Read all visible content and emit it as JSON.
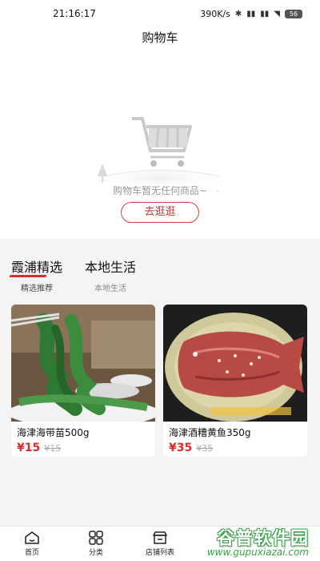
{
  "status_bar": {
    "time": "21:16:17",
    "speed": "390K/s",
    "battery": "56"
  },
  "header": {
    "title": "购物车"
  },
  "empty_state": {
    "message": "购物车暂无任何商品~",
    "button_label": "去逛逛"
  },
  "tabs": [
    {
      "title": "霞浦精选",
      "subtitle": "精选推荐",
      "active": true
    },
    {
      "title": "本地生活",
      "subtitle": "本地生活",
      "active": false
    }
  ],
  "products": [
    {
      "name": "海津海带苗500g",
      "price": "¥15",
      "original_price": "¥15"
    },
    {
      "name": "海津酒糟黄鱼350g",
      "price": "¥35",
      "original_price": "¥35"
    }
  ],
  "bottom_nav": [
    {
      "label": "首页",
      "icon": "home-icon"
    },
    {
      "label": "分类",
      "icon": "grid-icon"
    },
    {
      "label": "店铺列表",
      "icon": "store-icon"
    }
  ],
  "watermark": {
    "brand": "谷普软件园",
    "url": "www.gupuxiazai.com"
  },
  "colors": {
    "accent": "#d32f2f",
    "background_lower": "#f4f4f4",
    "watermark_green": "#3aa04b"
  }
}
